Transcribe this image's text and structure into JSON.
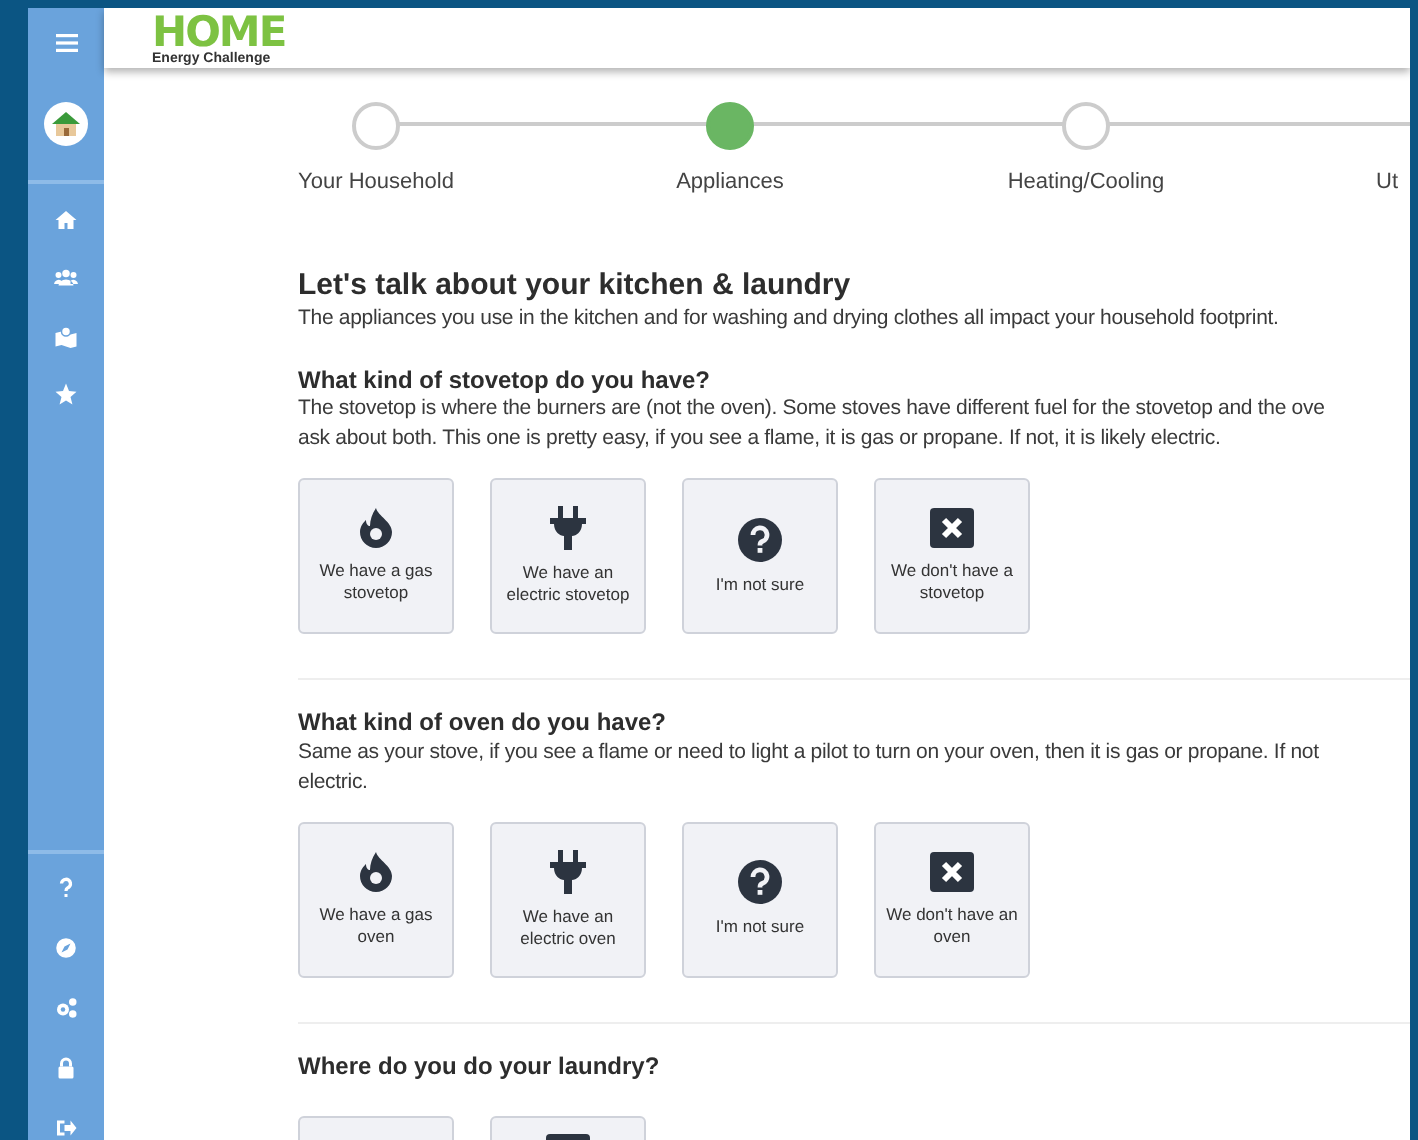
{
  "logo": {
    "title": "HOME",
    "subtitle": "Energy Challenge"
  },
  "sidebar": {
    "top_items": [
      {
        "kind": "home"
      },
      {
        "kind": "group"
      },
      {
        "kind": "map"
      },
      {
        "kind": "star"
      }
    ],
    "bottom_items": [
      {
        "kind": "help"
      },
      {
        "kind": "compass"
      },
      {
        "kind": "gears"
      },
      {
        "kind": "lock"
      },
      {
        "kind": "exit"
      }
    ]
  },
  "steps": [
    {
      "label": "Your Household",
      "selected": false
    },
    {
      "label": "Appliances",
      "selected": true
    },
    {
      "label": "Heating/Cooling",
      "selected": false
    },
    {
      "label": "Ut"
    }
  ],
  "intro": {
    "title": "Let's talk about your kitchen & laundry",
    "text": "The appliances you use in the kitchen and for washing and drying clothes all impact your household footprint."
  },
  "questions": [
    {
      "title": "What kind of stovetop do you have?",
      "lines": [
        "The stovetop is where the burners are (not the oven). Some stoves have different fuel for the stovetop and the ove",
        "ask about both.  This one is pretty easy, if you see a flame, it is gas or propane.  If not, it is likely electric."
      ],
      "options": [
        {
          "kind": "flame",
          "label": "We have a gas stovetop"
        },
        {
          "kind": "plug",
          "label": "We have an electric stovetop"
        },
        {
          "kind": "question",
          "label": "I'm not sure"
        },
        {
          "kind": "x",
          "label": "We don't have a stovetop"
        }
      ]
    },
    {
      "title": "What kind of oven do you have?",
      "lines": [
        "Same as your stove, if you see a flame or need to light a pilot to turn on your oven, then it is gas or propane. If not",
        "electric."
      ],
      "options": [
        {
          "kind": "flame",
          "label": "We have a gas oven"
        },
        {
          "kind": "plug",
          "label": "We have an electric oven"
        },
        {
          "kind": "question",
          "label": "I'm not sure"
        },
        {
          "kind": "x",
          "label": "We don't have an oven"
        }
      ]
    },
    {
      "title": "Where do you do your laundry?",
      "options": [
        {
          "kind": "blank"
        },
        {
          "kind": "box"
        }
      ]
    }
  ]
}
